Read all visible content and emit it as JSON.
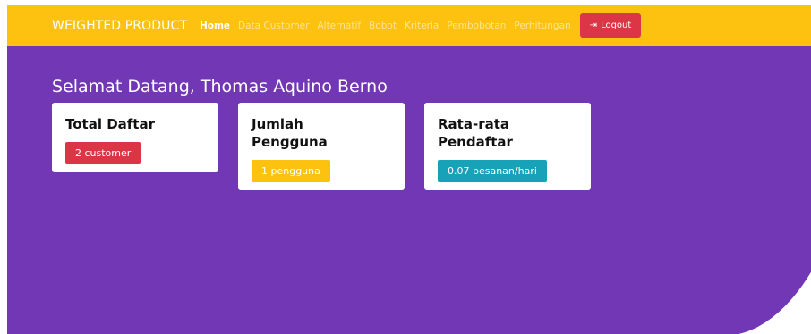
{
  "navbar": {
    "brand": "WEIGHTED PRODUCT",
    "links": [
      {
        "label": "Home",
        "active": true
      },
      {
        "label": "Data Customer",
        "active": false
      },
      {
        "label": "Alternatif",
        "active": false
      },
      {
        "label": "Bobot",
        "active": false
      },
      {
        "label": "Kriteria",
        "active": false
      },
      {
        "label": "Pembobotan",
        "active": false
      },
      {
        "label": "Perhitungan",
        "active": false
      }
    ],
    "logout_label": "Logout",
    "logout_icon": "sign-out-icon"
  },
  "welcome": "Selamat Datang, Thomas Aquino Berno",
  "cards": [
    {
      "title": "Total Daftar",
      "badge": "2 customer",
      "badge_color": "#dc3545"
    },
    {
      "title": "Jumlah Pengguna",
      "badge": "1 pengguna",
      "badge_color": "#fdc20f"
    },
    {
      "title": "Rata-rata Pendaftar",
      "badge": "0.07 pesanan/hari",
      "badge_color": "#17a2b8"
    }
  ],
  "colors": {
    "navbar": "#fdc20f",
    "background": "#7237b4",
    "danger": "#dc3545",
    "info": "#17a2b8"
  }
}
